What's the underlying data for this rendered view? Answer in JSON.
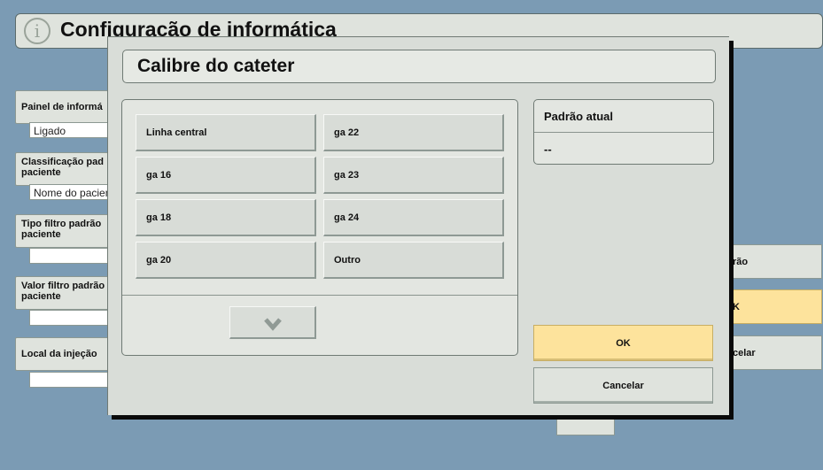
{
  "background": {
    "title": "Configuração de informática",
    "left_items": [
      {
        "label": "Painel de informá",
        "value": "Ligado"
      },
      {
        "label": "Classificação pad\npaciente",
        "value": "Nome do pacient"
      },
      {
        "label": "Tipo filtro padrão\npaciente",
        "value": ""
      },
      {
        "label": "Valor filtro padrão\npaciente",
        "value": ""
      },
      {
        "label": "Local da injeção",
        "value": ""
      }
    ],
    "right_buttons": [
      "rão",
      "K",
      "celar"
    ]
  },
  "dialog": {
    "title": "Calibre do cateter",
    "options": [
      "Linha central",
      "ga 22",
      "ga 16",
      "ga 23",
      "ga 18",
      "ga 24",
      "ga 20",
      "Outro"
    ],
    "scroll_icon": "chevron-down-icon",
    "current_default": {
      "label": "Padrão atual",
      "value": "--"
    },
    "ok_label": "OK",
    "cancel_label": "Cancelar"
  },
  "colors": {
    "background": "#7b9bb4",
    "panel": "#dfe3dd",
    "ok_accent": "#fde39c"
  }
}
